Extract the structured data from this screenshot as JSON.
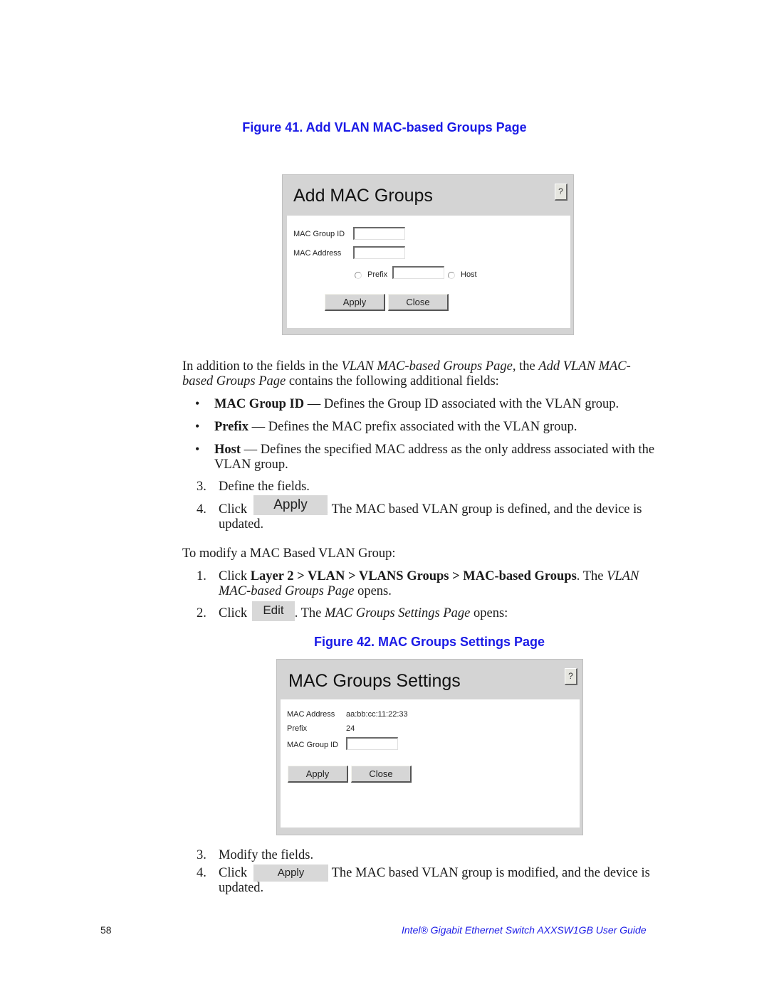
{
  "figure41": {
    "caption": "Figure 41. Add VLAN MAC-based Groups Page",
    "panel": {
      "title": "Add MAC Groups",
      "help_label": "?",
      "fields": {
        "mac_group_id_label": "MAC Group ID",
        "mac_group_id_value": "",
        "mac_address_label": "MAC Address",
        "mac_address_value": "",
        "prefix_label": "Prefix",
        "prefix_value": "",
        "host_label": "Host"
      },
      "buttons": {
        "apply": "Apply",
        "close": "Close"
      }
    }
  },
  "intro": {
    "text_1": "In addition to the fields in the ",
    "italic_1": "VLAN MAC-based Groups Page",
    "text_2": ", the ",
    "italic_2": "Add VLAN MAC-",
    "italic_3": "based Groups Page",
    "text_3": " contains the following additional fields:"
  },
  "bullets": [
    {
      "term": "MAC Group ID",
      "desc": " — Defines the Group ID associated with the VLAN group."
    },
    {
      "term": "Prefix",
      "desc": " — Defines the MAC prefix associated with the VLAN group."
    },
    {
      "term": "Host",
      "desc": " — Defines the specified MAC address as the only address associated with the",
      "desc_cont": "VLAN group."
    }
  ],
  "steps_add": [
    {
      "num": "3.",
      "text": "Define the fields."
    },
    {
      "num": "4.",
      "pre": "Click",
      "button": "Apply",
      "post": ". The MAC based VLAN group is defined, and the device is",
      "cont": "updated."
    }
  ],
  "modify_intro": "To modify a MAC Based VLAN Group:",
  "steps_modify": [
    {
      "num": "1.",
      "pre": "Click ",
      "bold": "Layer 2 > VLAN > VLANS Groups > MAC-based Groups",
      "post": ". The ",
      "italic": "VLAN",
      "cont_italic": "MAC-based Groups Page",
      "cont": " opens."
    },
    {
      "num": "2.",
      "pre": "Click",
      "button": "Edit",
      "post": ". The ",
      "italic": "MAC Groups Settings Page",
      "post2": " opens:"
    }
  ],
  "figure42": {
    "caption": "Figure 42. MAC Groups Settings Page",
    "panel": {
      "title": "MAC Groups Settings",
      "help_label": "?",
      "mac_address_label": "MAC Address",
      "mac_address_value": "aa:bb:cc:11:22:33",
      "prefix_label": "Prefix",
      "prefix_value": "24",
      "mac_group_id_label": "MAC Group ID",
      "mac_group_id_value": "",
      "buttons": {
        "apply": "Apply",
        "close": "Close"
      }
    }
  },
  "steps_final": [
    {
      "num": "3.",
      "text": "Modify the fields."
    },
    {
      "num": "4.",
      "pre": "Click",
      "button": "Apply",
      "post": ". The MAC based VLAN group is modified, and the device is",
      "cont": "updated."
    }
  ],
  "footer": {
    "page_number": "58",
    "title": "Intel® Gigabit Ethernet Switch AXXSW1GB User Guide"
  }
}
